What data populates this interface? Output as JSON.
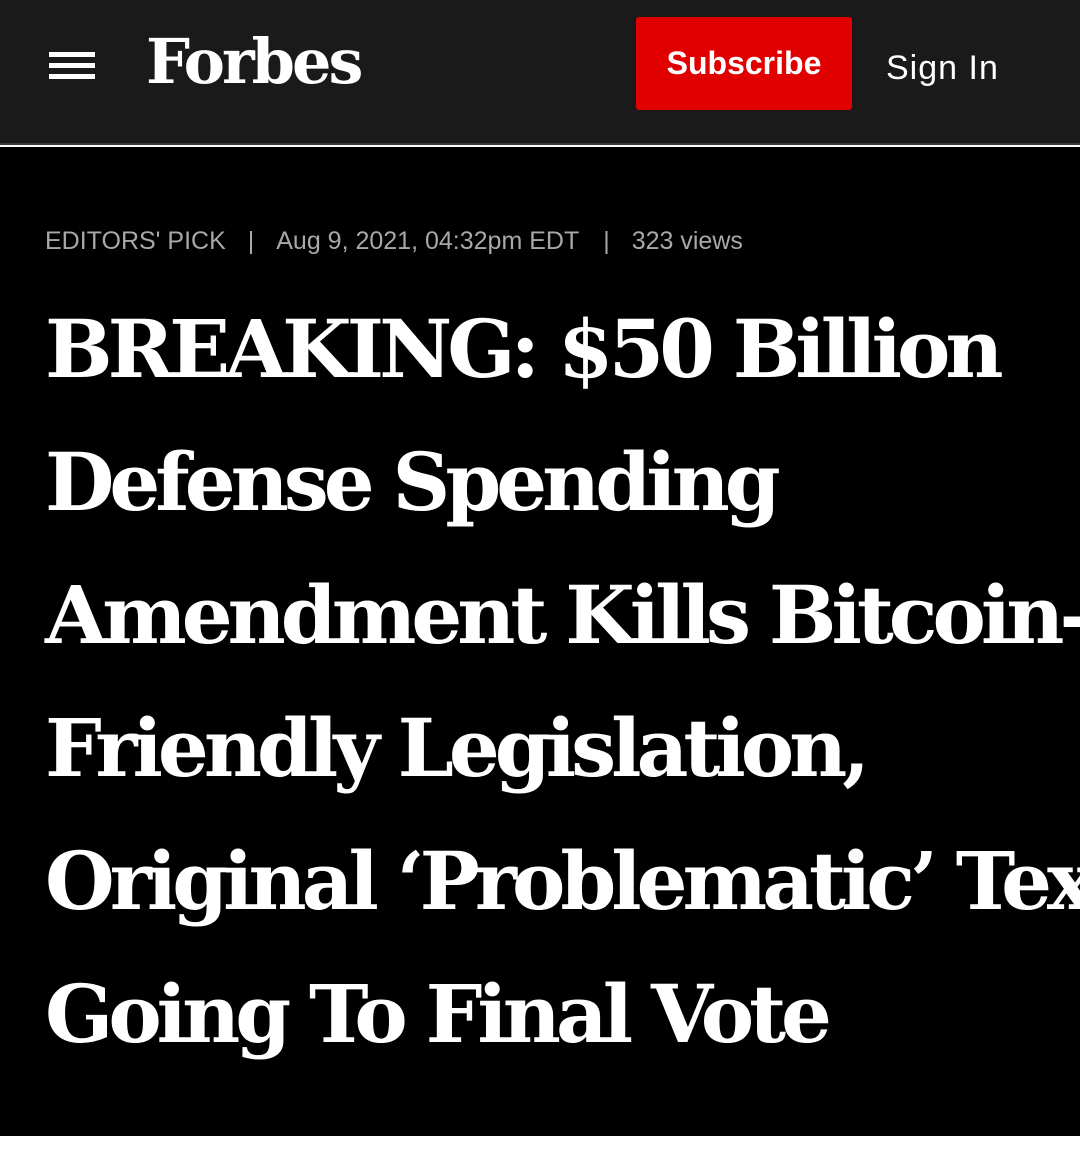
{
  "header": {
    "logo": "Forbes",
    "subscribe_label": "Subscribe",
    "signin_label": "Sign In",
    "menu_icon": "hamburger-menu-icon"
  },
  "article": {
    "category": "EDITORS' PICK",
    "separator": "|",
    "timestamp": "Aug 9, 2021, 04:32pm EDT",
    "views": "323 views",
    "headline_lines": [
      "BREAKING: $50 Billion",
      "Defense Spending",
      "Amendment Kills Bitcoin-",
      "Friendly Legislation,",
      "Original ‘Problematic’ Text",
      "Going To Final Vote"
    ]
  },
  "colors": {
    "header_bg": "#1a1a1a",
    "hero_bg": "#000000",
    "subscribe_bg": "#e00000",
    "meta_text": "#a8a8a8",
    "headline_text": "#ffffff"
  }
}
